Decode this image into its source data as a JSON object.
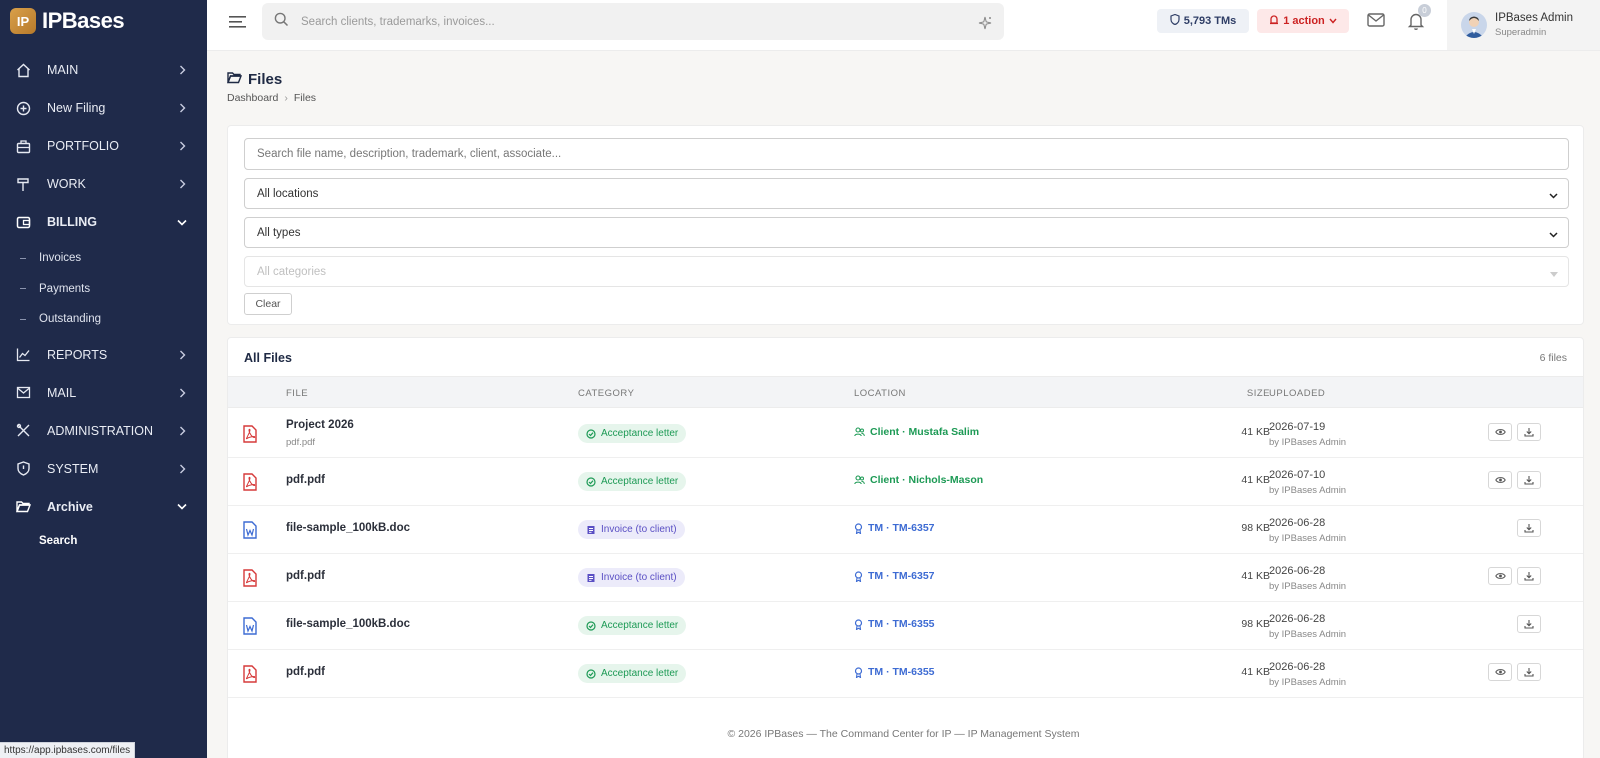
{
  "app": {
    "logo_badge": "IP",
    "logo_text": "IPBases"
  },
  "sidebar": {
    "items": [
      {
        "label": "MAIN",
        "icon": "home-icon"
      },
      {
        "label": "New Filing",
        "icon": "plus-circle-icon"
      },
      {
        "label": "PORTFOLIO",
        "icon": "briefcase-icon"
      },
      {
        "label": "WORK",
        "icon": "hammer-icon"
      },
      {
        "label": "BILLING",
        "icon": "wallet-icon",
        "expanded": true
      },
      {
        "label": "REPORTS",
        "icon": "chart-line-icon"
      },
      {
        "label": "MAIL",
        "icon": "mail-send-icon"
      },
      {
        "label": "ADMINISTRATION",
        "icon": "tools-icon"
      },
      {
        "label": "SYSTEM",
        "icon": "shield-icon"
      },
      {
        "label": "Archive",
        "icon": "folder-open-icon",
        "expanded": true
      }
    ],
    "billing_sub": [
      {
        "label": "Invoices"
      },
      {
        "label": "Payments"
      },
      {
        "label": "Outstanding"
      }
    ],
    "archive_sub": [
      {
        "label": "Search",
        "active": true
      }
    ],
    "status_url": "https://app.ipbases.com/files"
  },
  "topbar": {
    "search_placeholder": "Search clients, trademarks, invoices...",
    "tms_label": "5,793 TMs",
    "action_label": "1 action",
    "notification_count": "0",
    "user_name": "IPBases Admin",
    "user_role": "Superadmin"
  },
  "page": {
    "title": "Files",
    "breadcrumb": [
      "Dashboard",
      "Files"
    ]
  },
  "filters": {
    "search_placeholder": "Search file name, description, trademark, client, associate...",
    "location_value": "All locations",
    "type_value": "All types",
    "category_placeholder": "All categories",
    "clear_label": "Clear"
  },
  "table": {
    "title": "All Files",
    "count": "6 files",
    "columns": {
      "file": "FILE",
      "category": "CATEGORY",
      "location": "LOCATION",
      "size": "SIZE",
      "uploaded": "UPLOADED"
    },
    "rows": [
      {
        "name": "Project 2026",
        "sub": "pdf.pdf",
        "type": "pdf",
        "category": "Acceptance letter",
        "category_color": "green",
        "location": "Client · Mustafa Salim",
        "location_kind": "client",
        "size": "41 KB",
        "date": "2026-07-19",
        "by": "by IPBases Admin",
        "viewable": true
      },
      {
        "name": "pdf.pdf",
        "sub": "",
        "type": "pdf",
        "category": "Acceptance letter",
        "category_color": "green",
        "location": "Client · Nichols-Mason",
        "location_kind": "client",
        "size": "41 KB",
        "date": "2026-07-10",
        "by": "by IPBases Admin",
        "viewable": true
      },
      {
        "name": "file-sample_100kB.doc",
        "sub": "",
        "type": "doc",
        "category": "Invoice (to client)",
        "category_color": "purple",
        "location": "TM · TM-6357",
        "location_kind": "tm",
        "size": "98 KB",
        "date": "2026-06-28",
        "by": "by IPBases Admin",
        "viewable": false
      },
      {
        "name": "pdf.pdf",
        "sub": "",
        "type": "pdf",
        "category": "Invoice (to client)",
        "category_color": "purple",
        "location": "TM · TM-6357",
        "location_kind": "tm",
        "size": "41 KB",
        "date": "2026-06-28",
        "by": "by IPBases Admin",
        "viewable": true
      },
      {
        "name": "file-sample_100kB.doc",
        "sub": "",
        "type": "doc",
        "category": "Acceptance letter",
        "category_color": "green",
        "location": "TM · TM-6355",
        "location_kind": "tm",
        "size": "98 KB",
        "date": "2026-06-28",
        "by": "by IPBases Admin",
        "viewable": false
      },
      {
        "name": "pdf.pdf",
        "sub": "",
        "type": "pdf",
        "category": "Acceptance letter",
        "category_color": "green",
        "location": "TM · TM-6355",
        "location_kind": "tm",
        "size": "41 KB",
        "date": "2026-06-28",
        "by": "by IPBases Admin",
        "viewable": true
      }
    ]
  },
  "footer": {
    "text": "© 2026 IPBases — The Command Center for IP — IP Management System"
  },
  "colors": {
    "sidebar": "#1f2a4a",
    "accent_green": "#1d9a55",
    "accent_blue": "#3d6bd3",
    "accent_purple": "#5a4fc4",
    "pdf_red": "#d63a3a",
    "action_red": "#c22"
  }
}
